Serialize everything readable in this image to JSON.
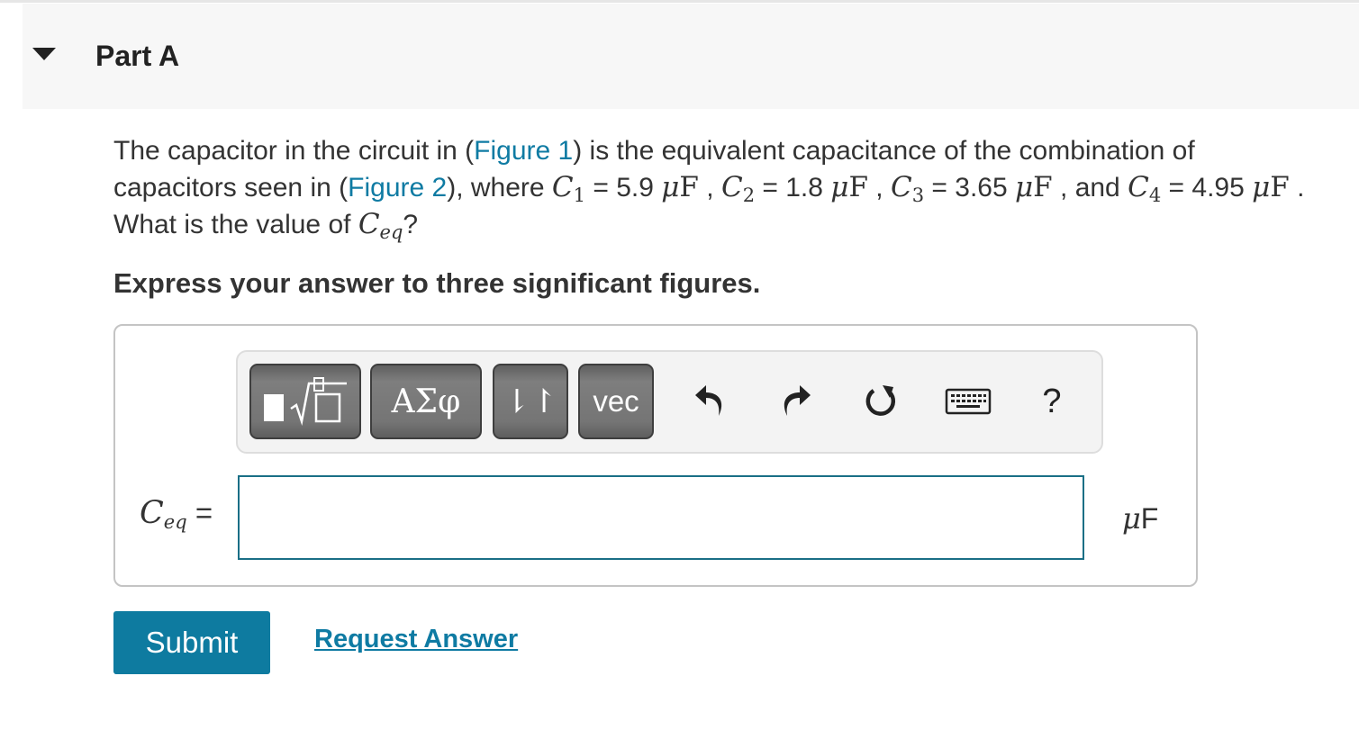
{
  "part": {
    "title": "Part A"
  },
  "question": {
    "t1": "The capacitor in the circuit in (",
    "figure1": "Figure 1",
    "t2": ") is the equivalent capacitance of the combination of capacitors seen in (",
    "figure2": "Figure 2",
    "t3": "), where ",
    "c1_sym": "C",
    "c1_sub": "1",
    "c1_val": " = 5.9 ",
    "c2_sym": "C",
    "c2_sub": "2",
    "c2_val": " = 1.8 ",
    "c3_sym": "C",
    "c3_sub": "3",
    "c3_val": " = 3.65 ",
    "c4_sym": "C",
    "c4_sub": "4",
    "c4_val": " = 4.95 ",
    "unit_mu": "μ",
    "unit_F": "F",
    "sep": " , ",
    "and": " , and ",
    "t4": " . What is the value of ",
    "ceq_sym": "C",
    "ceq_sub": "eq",
    "t5": "?"
  },
  "instruction": "Express your answer to three significant figures.",
  "toolbar": {
    "greek_label": "ΑΣφ",
    "arrows_label": "⇂↾",
    "vec_label": "vec",
    "help_label": "?"
  },
  "answer": {
    "lhs_sym": "C",
    "lhs_sub": "eq",
    "equals": " =",
    "value": "",
    "unit_mu": "μ",
    "unit_F": "F"
  },
  "actions": {
    "submit_label": "Submit",
    "request_label": "Request Answer"
  }
}
